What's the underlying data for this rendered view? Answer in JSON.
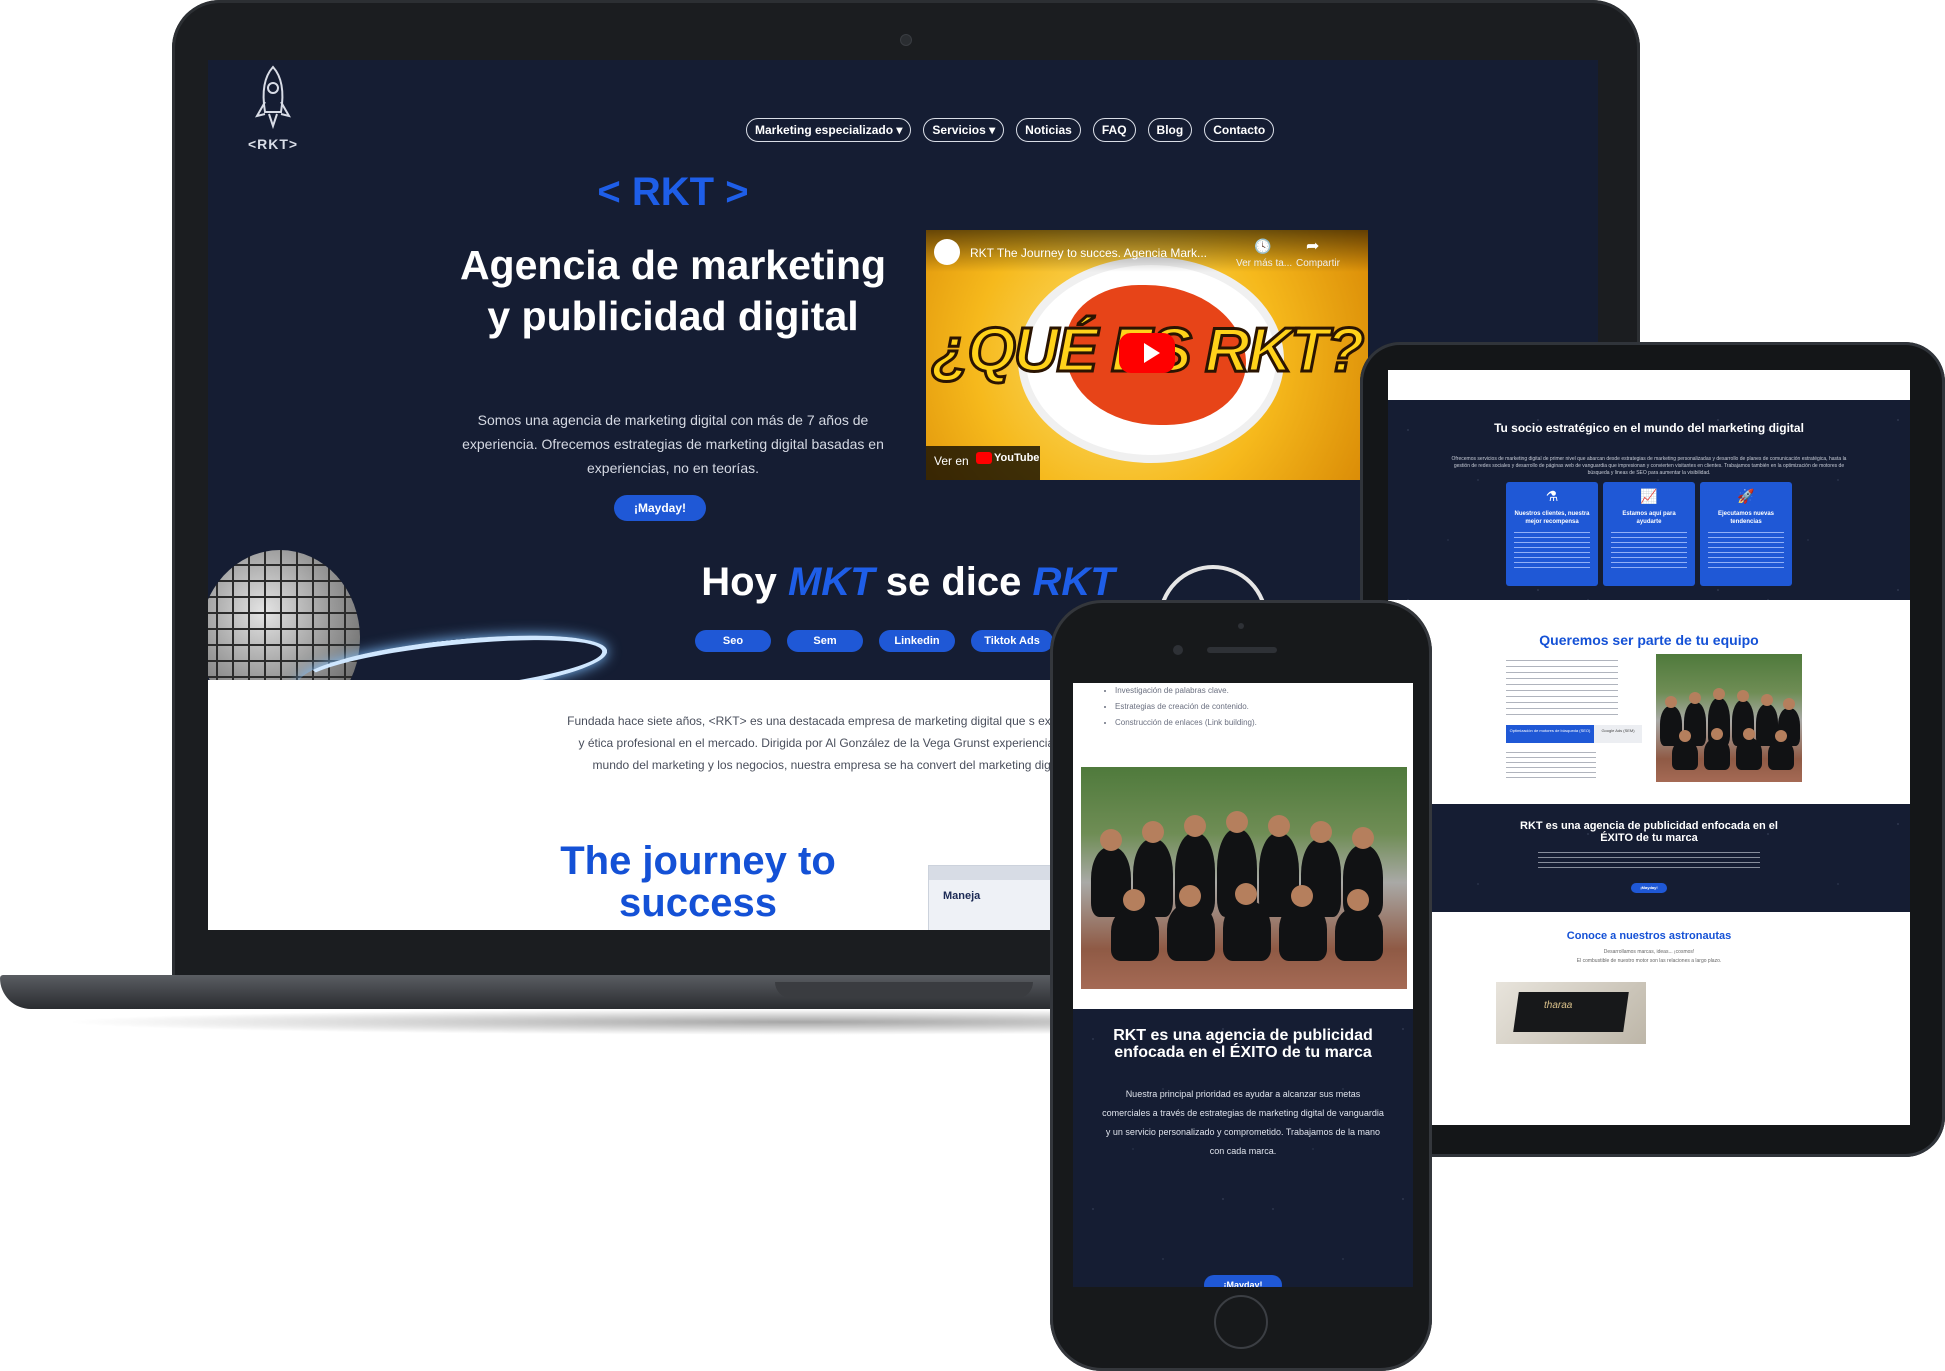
{
  "laptop": {
    "logo_text": "<RKT>",
    "nav": [
      {
        "label": "Marketing especializado",
        "caret": true
      },
      {
        "label": "Servicios",
        "caret": true
      },
      {
        "label": "Noticias",
        "caret": false
      },
      {
        "label": "FAQ",
        "caret": false
      },
      {
        "label": "Blog",
        "caret": false
      },
      {
        "label": "Contacto",
        "caret": false
      }
    ],
    "hero": {
      "brand": "< RKT >",
      "title": "Agencia de marketing y publicidad digital",
      "description": "Somos una agencia de marketing digital con más de 7 años de experiencia. Ofrecemos estrategias de marketing digital basadas en experiencias, no en teorías.",
      "button": "¡Mayday!"
    },
    "video": {
      "title": "RKT The Journey to succes. Agencia Mark...",
      "watch_later": "Ver más ta...",
      "share": "Compartir",
      "overlay_text": "¿QUÉ ES RKT?",
      "watch_on": "Ver en",
      "platform": "YouTube"
    },
    "slogan": {
      "part1": "Hoy",
      "part2": "MKT",
      "part3": "se dice",
      "part4": "RKT"
    },
    "tags": [
      "Seo",
      "Sem",
      "Linkedin",
      "Tiktok Ads",
      ""
    ],
    "about": "Fundada hace siete años, <RKT> es una destacada empresa de marketing digital que s excelencia y ética profesional en el mercado. Dirigida por Al González de la Vega Grunst experiencia en el mundo del marketing y los negocios, nuestra empresa se ha convert del marketing digital.",
    "journey": "The journey to success",
    "manage_label": "Maneja"
  },
  "tablet": {
    "section1_title": "Tu socio estratégico en el mundo del marketing digital",
    "section1_text": "Ofrecemos servicios de marketing digital de primer nivel que abarcan desde estrategias de marketing personalizadas y desarrollo de planes de comunicación estratégica, hasta la gestión de redes sociales y desarrollo de páginas web de vanguardia que impresionan y convierten visitantes en clientes. Trabajamos también en la optimización de motores de búsqueda y lineas de SEO para aumentar la visibilidad.",
    "cards": [
      {
        "icon": "⚗",
        "title": "Nuestros clientes, nuestra mejor recompensa"
      },
      {
        "icon": "📈",
        "title": "Estamos aquí para ayudarte"
      },
      {
        "icon": "🚀",
        "title": "Ejecutamos nuevas tendencias"
      }
    ],
    "section2_title": "Queremos ser parte de tu equipo",
    "tab_active": "Optimización de motores de búsqueda (SEO)",
    "tab_inactive": "Google Ads (SEM)",
    "section3_title": "RKT es una agencia de publicidad enfocada en el ÉXITO de tu marca",
    "section3_button": "¡Mayday!",
    "section4_title": "Conoce a nuestros astronautas",
    "section4_sub1": "Desarrollamos marcas, ideas... ¡cosmos!",
    "section4_sub2": "El combustible de nuestro motor son las relaciones a largo plazo.",
    "product_label": "tharaa"
  },
  "phone": {
    "list": [
      "Investigación de palabras clave.",
      "Estrategias de creación de contenido.",
      "Construcción de enlaces (Link building)."
    ],
    "title": "RKT es una agencia de publicidad enfocada en el ÉXITO de tu marca",
    "text": "Nuestra principal prioridad es ayudar a alcanzar sus metas comerciales a través de estrategias de marketing digital de vanguardia y un servicio personalizado y comprometido. Trabajamos de la mano con cada marca.",
    "button": "¡Mayday!"
  },
  "colors": {
    "brand_blue": "#1f58d6",
    "dark_navy": "#151d33",
    "white": "#ffffff"
  }
}
